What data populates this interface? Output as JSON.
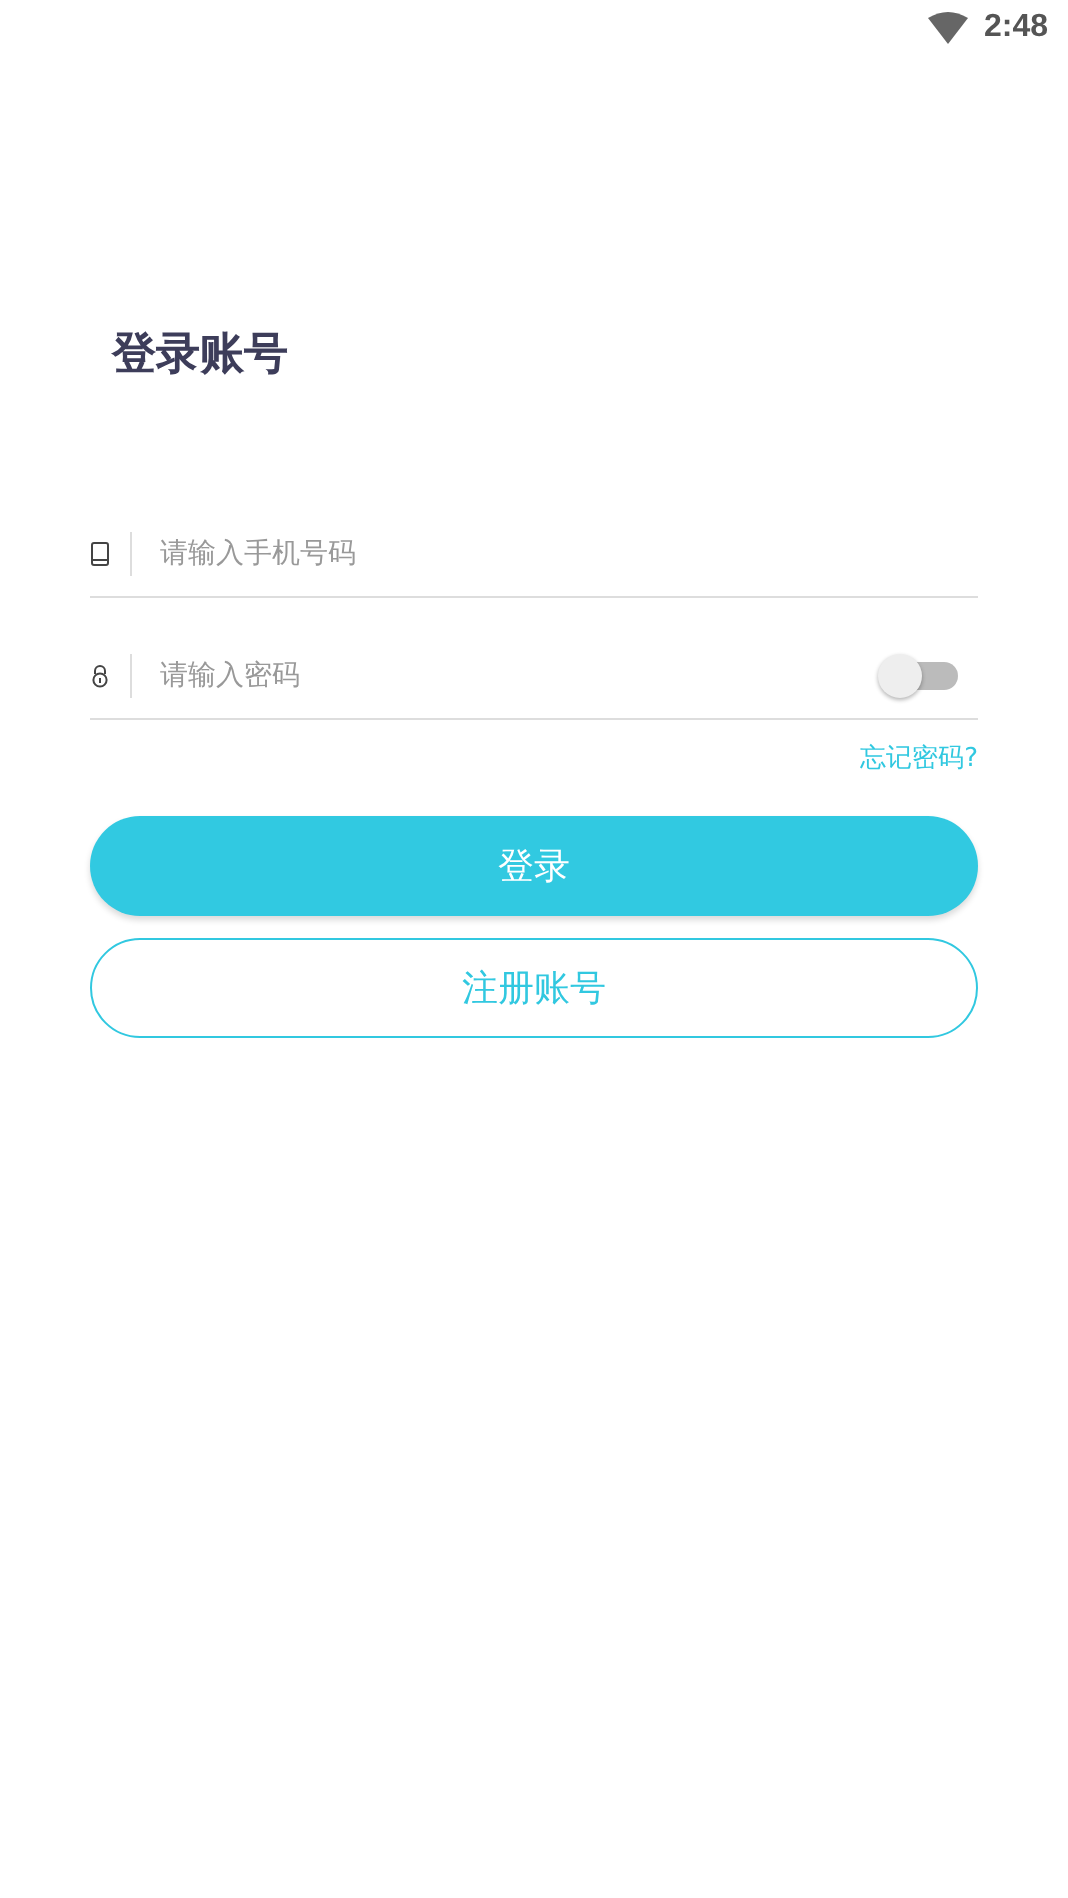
{
  "status_bar": {
    "time": "2:48"
  },
  "title": "登录账号",
  "fields": [
    {
      "kind": "phone",
      "placeholder": "请输入手机号码"
    },
    {
      "kind": "password",
      "placeholder": "请输入密码",
      "toggle": {
        "on": false
      }
    }
  ],
  "forgot_link": "忘记密码?",
  "buttons": [
    {
      "kind": "primary",
      "label": "登录"
    },
    {
      "kind": "outline",
      "label": "注册账号"
    }
  ]
}
